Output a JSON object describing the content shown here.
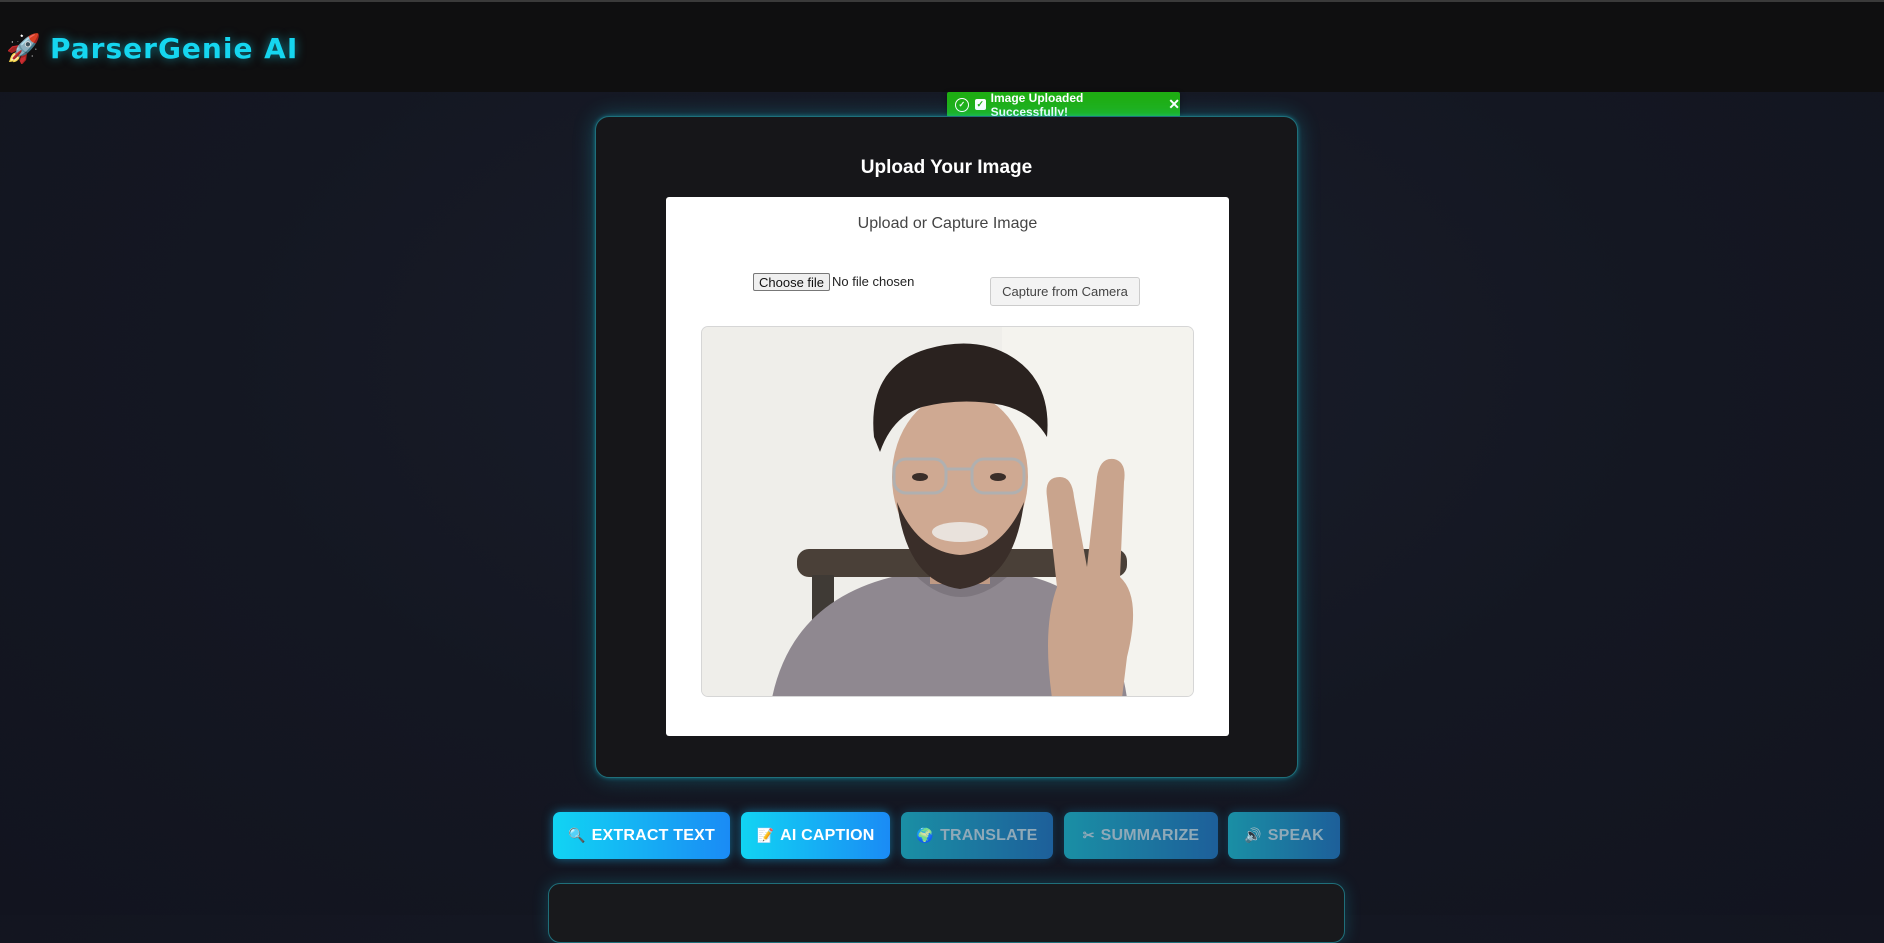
{
  "app": {
    "name": "ParserGenie AI",
    "logo_icon": "rocket-icon"
  },
  "toast": {
    "message": "Image Uploaded Successfully!",
    "color": "#1fae13"
  },
  "upload": {
    "heading": "Upload Your Image",
    "panel_title": "Upload or Capture Image",
    "file_button": "Choose file",
    "file_status": "No file chosen",
    "camera_button": "Capture from Camera"
  },
  "actions": [
    {
      "label": "EXTRACT TEXT",
      "icon": "magnifier-icon",
      "active": true
    },
    {
      "label": "AI CAPTION",
      "icon": "memo-icon",
      "active": true
    },
    {
      "label": "TRANSLATE",
      "icon": "globe-icon",
      "active": false
    },
    {
      "label": "SUMMARIZE",
      "icon": "scissors-icon",
      "active": false
    },
    {
      "label": "SPEAK",
      "icon": "speaker-icon",
      "active": false
    }
  ],
  "colors": {
    "accent": "#15d6f0",
    "success": "#1fae13",
    "button_gradient": [
      "#11d4f3",
      "#1a8bf5"
    ]
  }
}
